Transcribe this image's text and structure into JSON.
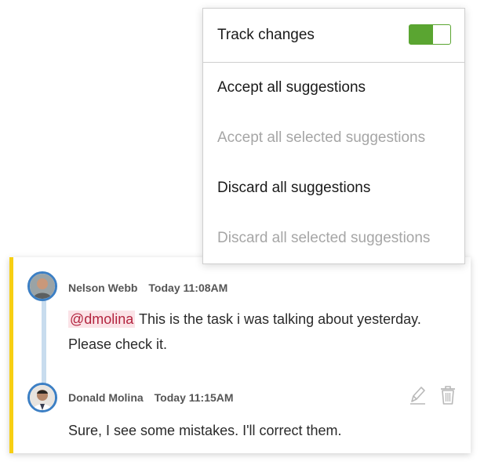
{
  "track_changes": {
    "label": "Track changes",
    "enabled": true,
    "accent_color": "#5aa531"
  },
  "menu_items": [
    {
      "label": "Accept all suggestions",
      "disabled": false
    },
    {
      "label": "Accept all selected suggestions",
      "disabled": true
    },
    {
      "label": "Discard all suggestions",
      "disabled": false
    },
    {
      "label": "Discard all selected suggestions",
      "disabled": true
    }
  ],
  "comments": [
    {
      "author": "Nelson Webb",
      "time": "Today 11:08AM",
      "mention": "@dmolina",
      "text": "This is the task i was talking about yesterday. Please check it."
    },
    {
      "author": "Donald Molina",
      "time": "Today 11:15AM",
      "text": "Sure, I see some mistakes. I'll correct them."
    }
  ],
  "colors": {
    "comment_marker": "#f7cf12",
    "avatar_ring": "#3c7fc4",
    "mention_text": "#b3243f",
    "mention_bg": "#fbe3e7"
  },
  "icons": {
    "edit": "pencil-icon",
    "delete": "trash-icon"
  }
}
